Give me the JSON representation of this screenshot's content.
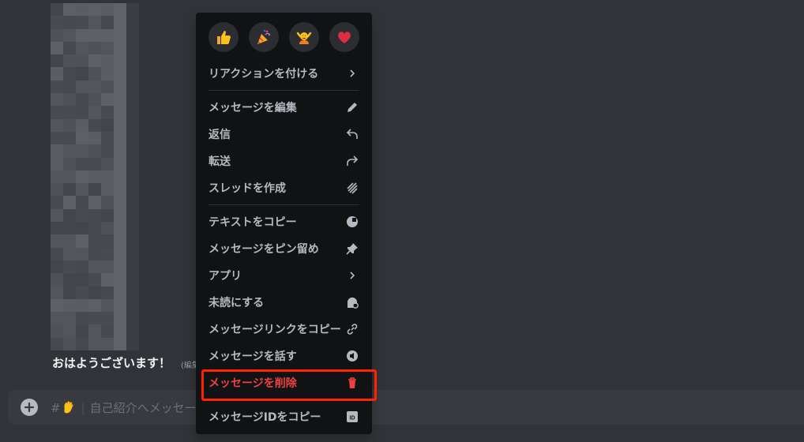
{
  "message": {
    "text": "おはようございます！",
    "edited": "(編集"
  },
  "chat_input": {
    "hash": "#",
    "placeholder": "自己紹介へメッセー"
  },
  "context_menu": {
    "reactions": [
      {
        "icon": "thumbs-up-emoji"
      },
      {
        "icon": "party-popper-emoji"
      },
      {
        "icon": "person-raising-hands-emoji"
      },
      {
        "icon": "red-heart-emoji"
      }
    ],
    "add_reaction": "リアクションを付ける",
    "edit_message": "メッセージを編集",
    "reply": "返信",
    "forward": "転送",
    "create_thread": "スレッドを作成",
    "copy_text": "テキストをコピー",
    "pin_message": "メッセージをピン留め",
    "apps": "アプリ",
    "mark_unread": "未読にする",
    "copy_message_link": "メッセージリンクをコピー",
    "speak_message": "メッセージを話す",
    "delete_message": "メッセージを削除",
    "copy_message_id": "メッセージIDをコピー"
  },
  "colors": {
    "background": "#313338",
    "menu_background": "#111214",
    "danger": "#f23f43",
    "highlight_outline": "#ff2400"
  }
}
